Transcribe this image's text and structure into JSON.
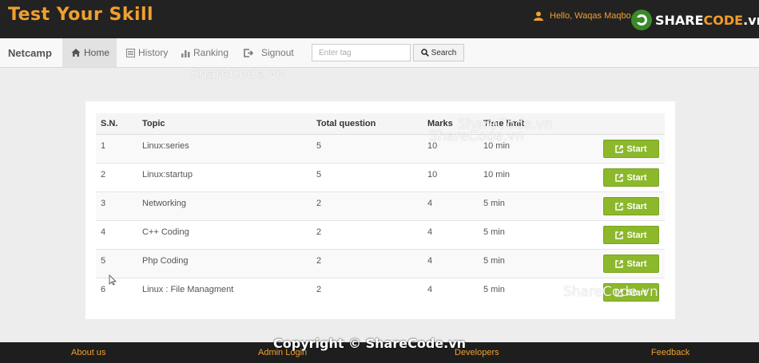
{
  "app": {
    "title": "Test Your Skill"
  },
  "user": {
    "greeting": "Hello,  Waqas Maqbo"
  },
  "logo": {
    "text_share": "SHARE",
    "text_code": "CODE",
    "text_tld": ".vn"
  },
  "navbar": {
    "brand": "Netcamp",
    "items": [
      {
        "label": "Home",
        "icon": "home-icon",
        "active": true
      },
      {
        "label": "History",
        "icon": "history-icon",
        "active": false
      },
      {
        "label": "Ranking",
        "icon": "bar-chart-icon",
        "active": false
      },
      {
        "label": "Signout",
        "icon": "signout-icon",
        "active": false
      }
    ],
    "tag_placeholder": "Enter tag",
    "search_label": "Search"
  },
  "watermarks": [
    "ShareCode.vn",
    "ShareCode.vn",
    "ShareCode.vn",
    "ShareCode.vn"
  ],
  "table": {
    "headers": [
      "S.N.",
      "Topic",
      "Total question",
      "Marks",
      "Time limit"
    ],
    "rows": [
      {
        "sn": "1",
        "topic": "Linux:series",
        "total": "5",
        "marks": "10",
        "time": "10 min"
      },
      {
        "sn": "2",
        "topic": "Linux:startup",
        "total": "5",
        "marks": "10",
        "time": "10 min"
      },
      {
        "sn": "3",
        "topic": "Networking",
        "total": "2",
        "marks": "4",
        "time": "5 min"
      },
      {
        "sn": "4",
        "topic": "C++ Coding",
        "total": "2",
        "marks": "4",
        "time": "5 min"
      },
      {
        "sn": "5",
        "topic": "Php Coding",
        "total": "2",
        "marks": "4",
        "time": "5 min"
      },
      {
        "sn": "6",
        "topic": "Linux : File Managment",
        "total": "2",
        "marks": "4",
        "time": "5 min"
      }
    ],
    "start_label": "Start"
  },
  "footer": {
    "links": [
      "About us",
      "Admin Login",
      "Developers",
      "Feedback"
    ],
    "copyright": "Copyright © ShareCode.vn"
  },
  "colors": {
    "brand": "#f0a030",
    "start_button": "#8cb82b",
    "topbar": "#222222"
  }
}
